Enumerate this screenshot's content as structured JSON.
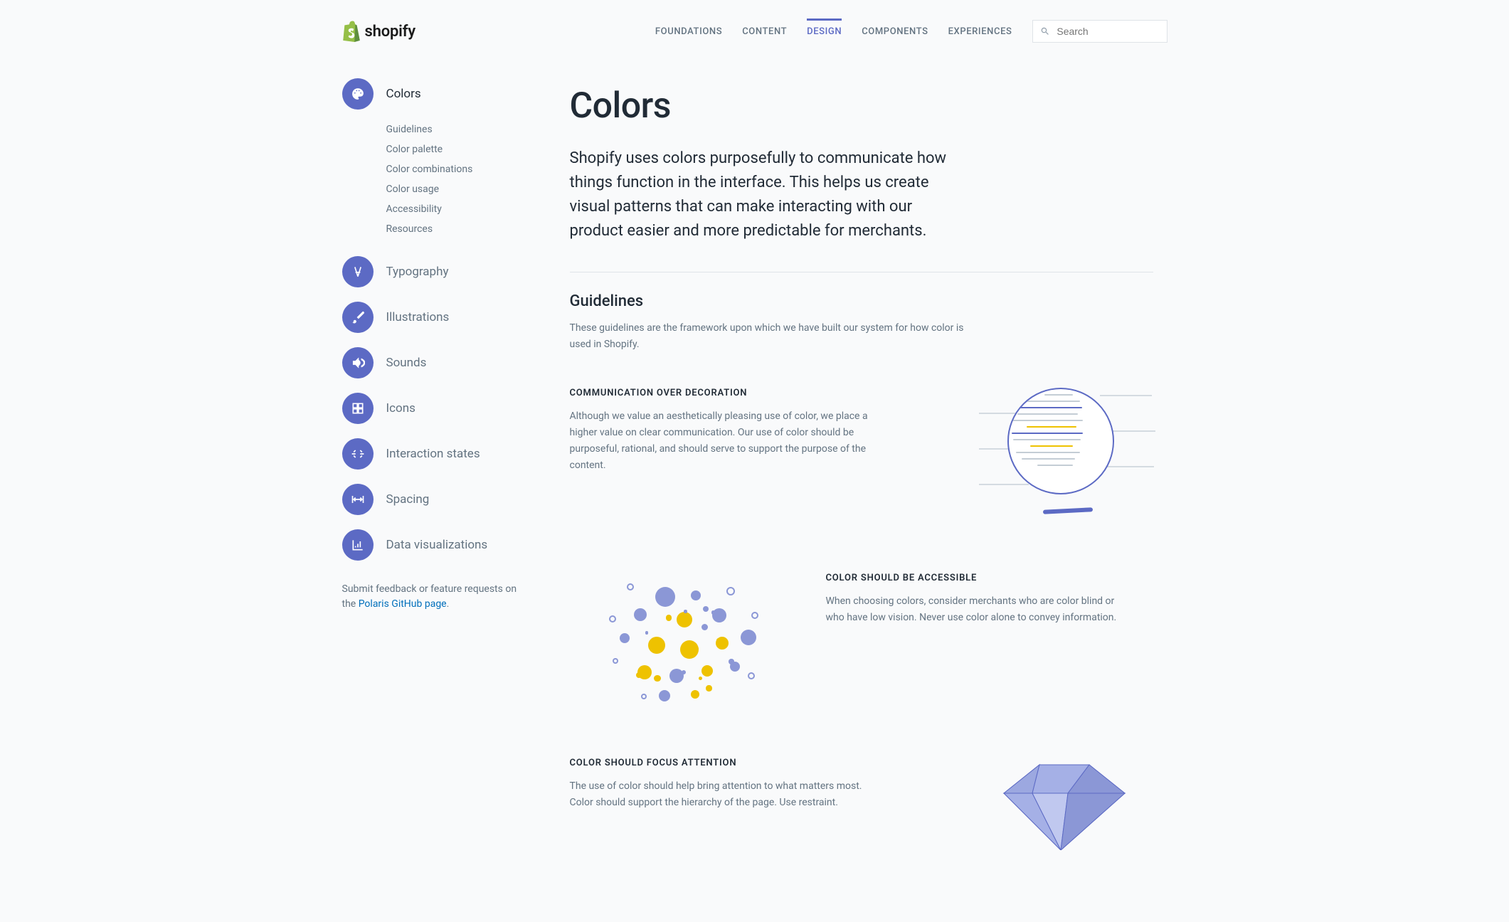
{
  "brand": "shopify",
  "nav": {
    "items": [
      "FOUNDATIONS",
      "CONTENT",
      "DESIGN",
      "COMPONENTS",
      "EXPERIENCES"
    ],
    "active_index": 2
  },
  "search": {
    "placeholder": "Search"
  },
  "sidebar": {
    "items": [
      {
        "label": "Colors",
        "icon": "palette",
        "active": true,
        "sub": [
          "Guidelines",
          "Color palette",
          "Color combinations",
          "Color usage",
          "Accessibility",
          "Resources"
        ]
      },
      {
        "label": "Typography",
        "icon": "type"
      },
      {
        "label": "Illustrations",
        "icon": "brush"
      },
      {
        "label": "Sounds",
        "icon": "sound"
      },
      {
        "label": "Icons",
        "icon": "grid"
      },
      {
        "label": "Interaction states",
        "icon": "interaction"
      },
      {
        "label": "Spacing",
        "icon": "spacing"
      },
      {
        "label": "Data visualizations",
        "icon": "chart"
      }
    ],
    "footer_prefix": "Submit feedback or feature requests on the ",
    "footer_link": "Polaris GitHub page",
    "footer_suffix": "."
  },
  "page": {
    "title": "Colors",
    "lead": "Shopify uses colors purposefully to communicate how things function in the interface. This helps us create visual patterns that can make interacting with our product easier and more predictable for merchants.",
    "section_heading": "Guidelines",
    "section_sub": "These guidelines are the framework upon which we have built our system for how color is used in Shopify.",
    "blocks": [
      {
        "eyebrow": "COMMUNICATION OVER DECORATION",
        "body": "Although we value an aesthetically pleasing use of color, we place a higher value on clear communication. Our use of color should be purposeful, rational, and should serve to support the purpose of the content.",
        "illus": "magnifier",
        "reverse": false
      },
      {
        "eyebrow": "COLOR SHOULD BE ACCESSIBLE",
        "body": "When choosing colors, consider merchants who are color blind or who have low vision. Never use color alone to convey information.",
        "illus": "dots",
        "reverse": true
      },
      {
        "eyebrow": "COLOR SHOULD FOCUS ATTENTION",
        "body": "The use of color should help bring attention to what matters most. Color should support the hierarchy of the page. Use restraint.",
        "illus": "gem",
        "reverse": false
      }
    ]
  }
}
